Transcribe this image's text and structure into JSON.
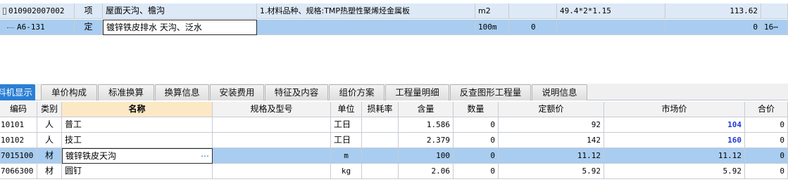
{
  "upper_rows": [
    {
      "code": "010902007002",
      "type": "项",
      "name": "屋面天沟、檐沟",
      "feature": "1.材料品种、规格:TMP热塑性聚烯烃金属板",
      "unit": "m2",
      "qty_expr": "",
      "expression": "49.4*2*1.15",
      "amount": "113.62",
      "extra": ""
    },
    {
      "code": "A6-131",
      "type": "定",
      "name": "镀锌铁皮排水 天沟、泛水",
      "feature": "",
      "unit": "100m",
      "qty_expr": "0",
      "expression": "",
      "amount": "0",
      "extra": "16⋯"
    }
  ],
  "tabs": [
    "料机显示",
    "单价构成",
    "标准换算",
    "换算信息",
    "安装费用",
    "特征及内容",
    "组价方案",
    "工程量明细",
    "反查图形工程量",
    "说明信息"
  ],
  "active_tab_index": 0,
  "lower_headers": {
    "code": "编码",
    "category": "类别",
    "name": "名称",
    "spec": "规格及型号",
    "unit": "单位",
    "loss": "损耗率",
    "content": "含量",
    "quantity": "数量",
    "quota_price": "定额价",
    "market_price": "市场价",
    "total": "合价"
  },
  "lower_rows": [
    {
      "code": "10101",
      "category": "人",
      "name": "普工",
      "spec": "",
      "unit": "工日",
      "loss": "",
      "content": "1.586",
      "quantity": "0",
      "quota_price": "92",
      "market_price": "104",
      "total": "0"
    },
    {
      "code": "10102",
      "category": "人",
      "name": "技工",
      "spec": "",
      "unit": "工日",
      "loss": "",
      "content": "2.379",
      "quantity": "0",
      "quota_price": "142",
      "market_price": "160",
      "total": "0"
    },
    {
      "code": "7015100",
      "category": "材",
      "name": "镀锌铁皮天沟",
      "spec": "",
      "unit": "m",
      "loss": "",
      "content": "100",
      "quantity": "0",
      "quota_price": "11.12",
      "market_price": "11.12",
      "total": "0"
    },
    {
      "code": "7066300",
      "category": "材",
      "name": "圆钉",
      "spec": "",
      "unit": "kg",
      "loss": "",
      "content": "2.06",
      "quantity": "0",
      "quota_price": "5.92",
      "market_price": "5.92",
      "total": "0"
    }
  ],
  "colors": {
    "selected_row": "#a9cdf0",
    "active_tab": "#2b7fd4",
    "market_price_highlight": "#1f3ccf"
  }
}
